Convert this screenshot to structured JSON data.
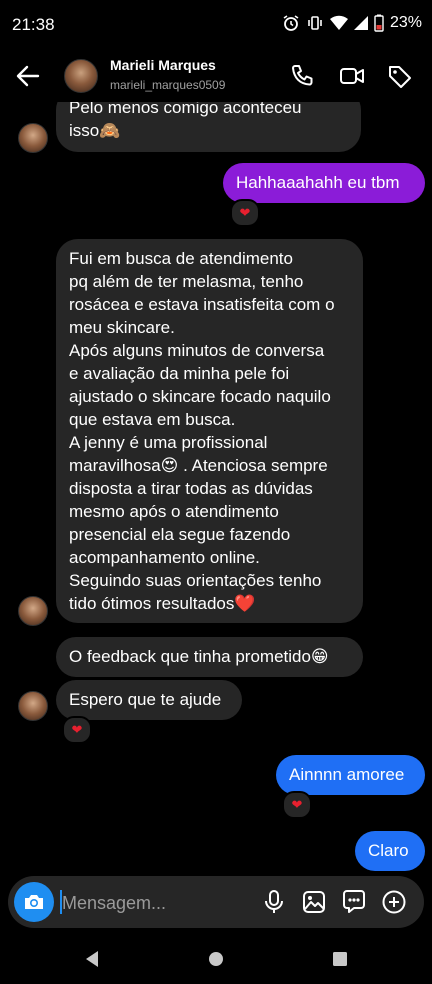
{
  "status": {
    "time": "21:38",
    "battery": "23%"
  },
  "header": {
    "name": "Marieli Marques",
    "username": "marieli_marques0509"
  },
  "messages": {
    "m1": {
      "line1": "Pelo menos comigo aconteceu",
      "line2": "isso🙈"
    },
    "m2": {
      "text": "Hahhaaahahh eu tbm"
    },
    "m3": {
      "lines": [
        "Fui em busca de atendimento",
        "pq além de ter melasma, tenho",
        "rosácea e estava insatisfeita com o",
        "meu skincare.",
        "Após alguns minutos de conversa",
        "e avaliação da minha pele foi",
        "ajustado o skincare focado naquilo",
        "que estava em busca.",
        "A jenny é uma profissional",
        "maravilhosa😍 . Atenciosa sempre",
        "disposta a tirar todas as dúvidas",
        "mesmo após o atendimento",
        "presencial ela segue fazendo",
        "acompanhamento online.",
        "Seguindo suas  orientações tenho",
        "tido ótimos resultados❤️"
      ]
    },
    "m4": {
      "text": "O feedback que tinha prometido😁"
    },
    "m5": {
      "text": "Espero que te ajude"
    },
    "m6": {
      "text": "Ainnnn amoree"
    },
    "m7": {
      "text": "Claro"
    }
  },
  "reaction": "❤",
  "composer": {
    "placeholder": "Mensagem..."
  },
  "colors": {
    "incoming": "#262626",
    "outgoing_purple": "#8b1cd8",
    "outgoing_blue": "#1f6ff5",
    "camera": "#1f8ef1"
  },
  "icons": [
    "back-arrow-icon",
    "phone-icon",
    "video-camera-icon",
    "tag-icon",
    "camera-icon",
    "microphone-icon",
    "gallery-icon",
    "sticker-icon",
    "plus-icon"
  ]
}
